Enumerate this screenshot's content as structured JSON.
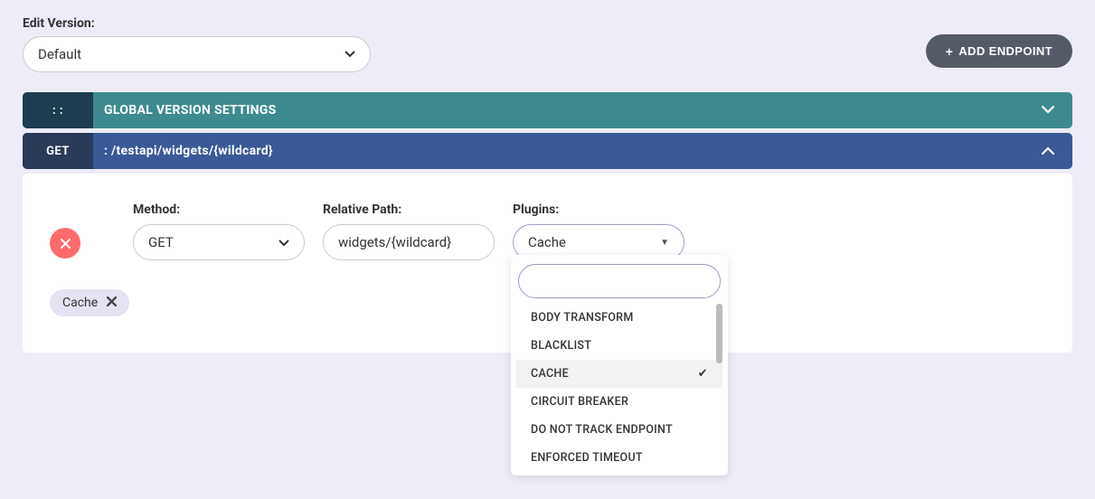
{
  "header": {
    "edit_version_label": "Edit Version:",
    "version_value": "Default",
    "add_endpoint_label": "ADD ENDPOINT"
  },
  "global_bar": {
    "chip": ": :",
    "title": "GLOBAL VERSION SETTINGS"
  },
  "endpoint_bar": {
    "chip": "GET",
    "title": ": /testapi/widgets/{wildcard}"
  },
  "form": {
    "method_label": "Method:",
    "method_value": "GET",
    "path_label": "Relative Path:",
    "path_value": "widgets/{wildcard}",
    "plugins_label": "Plugins:",
    "plugins_value": "Cache"
  },
  "chip": {
    "label": "Cache"
  },
  "dropdown": {
    "search_value": "",
    "items": [
      {
        "label": "BODY TRANSFORM",
        "selected": false
      },
      {
        "label": "BLACKLIST",
        "selected": false
      },
      {
        "label": "CACHE",
        "selected": true
      },
      {
        "label": "CIRCUIT BREAKER",
        "selected": false
      },
      {
        "label": "DO NOT TRACK ENDPOINT",
        "selected": false
      },
      {
        "label": "ENFORCED TIMEOUT",
        "selected": false
      }
    ]
  }
}
